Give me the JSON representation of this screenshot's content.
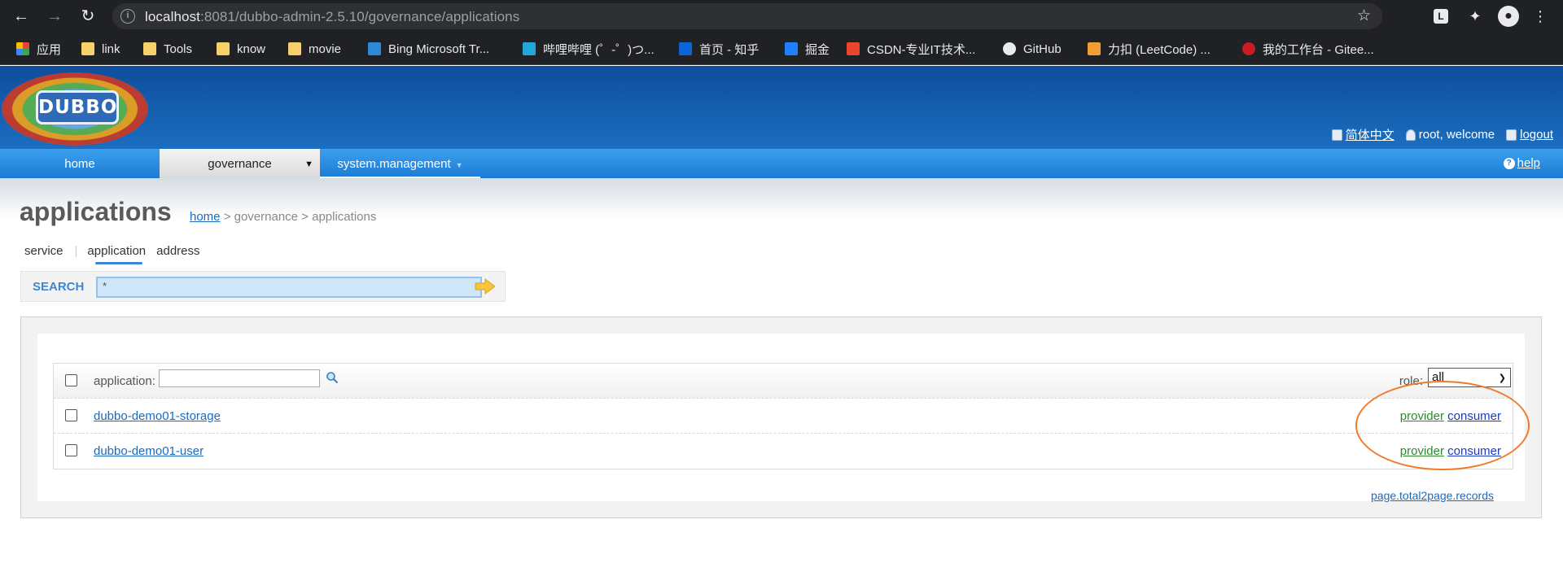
{
  "browser": {
    "url_host": "localhost",
    "url_rest": ":8081/dubbo-admin-2.5.10/governance/applications",
    "bookmarks": [
      {
        "label": "应用",
        "icon": "apps-grid-icon"
      },
      {
        "label": "link",
        "icon": "folder-icon"
      },
      {
        "label": "Tools",
        "icon": "folder-icon"
      },
      {
        "label": "know",
        "icon": "folder-icon"
      },
      {
        "label": "movie",
        "icon": "folder-icon"
      },
      {
        "label": "Bing Microsoft Tr...",
        "icon": "bing-icon"
      },
      {
        "label": "哔哩哔哩 (゜-゜)つ...",
        "icon": "bilibili-icon"
      },
      {
        "label": "首页 - 知乎",
        "icon": "zhihu-icon"
      },
      {
        "label": "掘金",
        "icon": "juejin-icon"
      },
      {
        "label": "CSDN-专业IT技术...",
        "icon": "csdn-icon"
      },
      {
        "label": "GitHub",
        "icon": "github-icon"
      },
      {
        "label": "力扣 (LeetCode) ...",
        "icon": "leetcode-icon"
      },
      {
        "label": "我的工作台 - Gitee...",
        "icon": "gitee-icon"
      }
    ]
  },
  "header": {
    "logo_text": "DUBBO",
    "lang_link": "简体中文",
    "user_text": "root, welcome",
    "logout": "logout"
  },
  "nav": {
    "home": "home",
    "governance": "governance",
    "system": "system.management",
    "help": "help"
  },
  "page": {
    "title": "applications",
    "breadcrumb": {
      "home": "home",
      "rest": " > governance > applications"
    }
  },
  "subtabs": {
    "service": "service",
    "application": "application",
    "address": "address"
  },
  "search": {
    "label": "SEARCH",
    "value": "*"
  },
  "table": {
    "filter_label": "application:",
    "role_label": "role:",
    "role_selected": "all",
    "rows": [
      {
        "name": "dubbo-demo01-storage",
        "provider": "provider",
        "consumer": "consumer"
      },
      {
        "name": "dubbo-demo01-user",
        "provider": "provider",
        "consumer": "consumer"
      }
    ]
  },
  "pager": "page.total2page.records",
  "colors": {
    "accent": "#1c7ad5",
    "provider": "#2c8a2c",
    "consumer": "#1a3ac0",
    "annotation": "#ef7a2a"
  }
}
